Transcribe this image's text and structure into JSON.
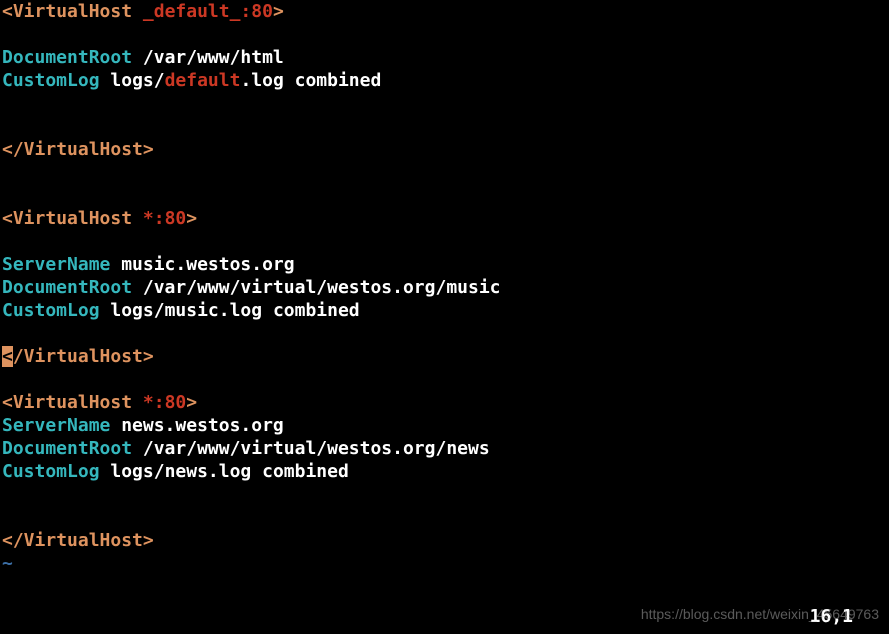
{
  "vhosts": [
    {
      "open_bracket": "<",
      "tag_open": "VirtualHost",
      "arg": " _default_:80",
      "close_bracket": ">",
      "directives": [
        {
          "name": "DocumentRoot",
          "space": " ",
          "value": "/var/www/html"
        },
        {
          "name": "CustomLog",
          "space": " ",
          "prefix": "logs/",
          "red": "default",
          "suffix": ".log combined"
        }
      ],
      "close_open": "<",
      "close_tag": "/VirtualHost",
      "close_close": ">"
    },
    {
      "open_bracket": "<",
      "tag_open": "VirtualHost",
      "arg": " *:80",
      "close_bracket": ">",
      "server_name_dir": "ServerName",
      "server_name_val": " music.westos.org",
      "doc_root_dir": "DocumentRoot",
      "doc_root_val": " /var/www/virtual/westos.org/music",
      "log_dir": "CustomLog",
      "log_val": " logs/music.log combined",
      "cursor_char": "<",
      "close_tag": "/VirtualHost",
      "close_close": ">"
    },
    {
      "open_bracket": "<",
      "tag_open": "VirtualHost",
      "arg": " *:80",
      "close_bracket": ">",
      "server_name_dir": "ServerName",
      "server_name_val": " news.westos.org",
      "doc_root_dir": "DocumentRoot",
      "doc_root_val": " /var/www/virtual/westos.org/news",
      "log_dir": "CustomLog",
      "log_val": " logs/news.log combined",
      "close_open": "<",
      "close_tag": "/VirtualHost",
      "close_close": ">"
    }
  ],
  "tilde": "~",
  "status": "16,1",
  "watermark": "https://blog.csdn.net/weixin_45649763"
}
